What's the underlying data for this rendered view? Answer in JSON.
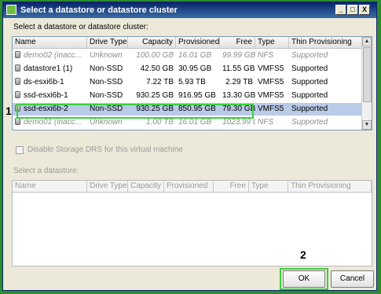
{
  "window": {
    "title": "Select a datastore or datastore cluster",
    "controls": [
      "_",
      "□",
      "X"
    ]
  },
  "top_label": "Select a datastore or datastore cluster:",
  "columns": [
    "Name",
    "Drive Type",
    "Capacity",
    "Provisioned",
    "Free",
    "Type",
    "Thin Provisioning"
  ],
  "rows": [
    {
      "name": "demo02 (inacc...",
      "drive": "Unknown",
      "capacity": "100.00 GB",
      "provisioned": "16.01 GB",
      "free": "99.99 GB",
      "type": "NFS",
      "thin": "Supported",
      "dim": true
    },
    {
      "name": "datastore1 (1)",
      "drive": "Non-SSD",
      "capacity": "42.50 GB",
      "provisioned": "30.95 GB",
      "free": "11.55 GB",
      "type": "VMFS5",
      "thin": "Supported"
    },
    {
      "name": "ds-esxi6b-1",
      "drive": "Non-SSD",
      "capacity": "7.22 TB",
      "provisioned": "5.93 TB",
      "free": "2.29 TB",
      "type": "VMFS5",
      "thin": "Supported"
    },
    {
      "name": "ssd-esxi6b-1",
      "drive": "Non-SSD",
      "capacity": "930.25 GB",
      "provisioned": "916.95 GB",
      "free": "13.30 GB",
      "type": "VMFS5",
      "thin": "Supported"
    },
    {
      "name": "ssd-esxi6b-2",
      "drive": "Non-SSD",
      "capacity": "930.25 GB",
      "provisioned": "850.95 GB",
      "free": "79.30 GB",
      "type": "VMFS5",
      "thin": "Supported",
      "selected": true
    },
    {
      "name": "demo01 (inacc...",
      "drive": "Unknown",
      "capacity": "1.00 TB",
      "provisioned": "16.01 GB",
      "free": "1023.99 G",
      "type": "NFS",
      "thin": "Supported",
      "dim": true
    }
  ],
  "drs_checkbox_label": "Disable Storage DRS for this virtual machine",
  "lower_label": "Select a datastore:",
  "lower_columns": [
    "Name",
    "Drive Type",
    "Capacity",
    "Provisioned",
    "Free",
    "Type",
    "Thin Provisioning"
  ],
  "annotations": {
    "step1": "1",
    "step2": "2"
  },
  "buttons": {
    "ok": "OK",
    "cancel": "Cancel"
  },
  "colors": {
    "highlight": "#3cd03c",
    "selected_row": "#b9cbe8",
    "background": "#2e8b2e"
  }
}
